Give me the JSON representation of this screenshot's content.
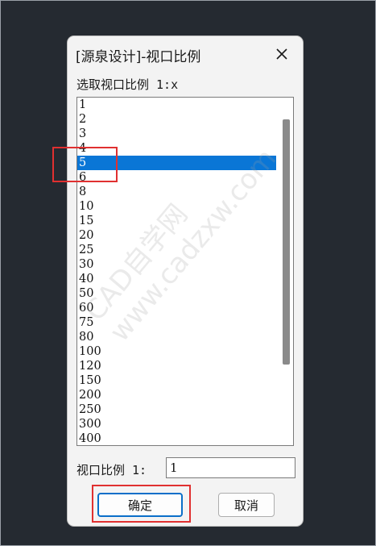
{
  "dialog": {
    "title": "[源泉设计]-视口比例",
    "close_icon": "close-icon",
    "prompt": "选取视口比例 1:x",
    "scale_label": "视口比例 1:",
    "scale_value": "1",
    "ok_label": "确定",
    "cancel_label": "取消"
  },
  "list": {
    "selected": "5",
    "items": [
      "1",
      "2",
      "3",
      "4",
      "5",
      "6",
      "8",
      "10",
      "15",
      "20",
      "25",
      "30",
      "40",
      "50",
      "60",
      "75",
      "80",
      "100",
      "120",
      "150",
      "200",
      "250",
      "300",
      "400"
    ]
  },
  "watermark": {
    "line1": "CAD自学网",
    "line2": "www.cadzxw.com"
  },
  "colors": {
    "selection": "#0a76d6",
    "highlight_box": "#e03030",
    "background": "#252a31"
  }
}
